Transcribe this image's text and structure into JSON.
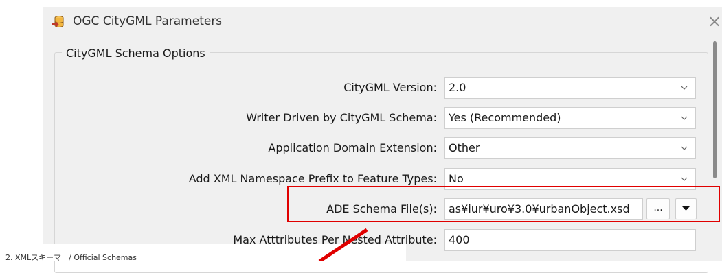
{
  "dialog": {
    "title": "OGC CityGML Parameters",
    "title_icon": "database-export-icon",
    "close_label": "×"
  },
  "group": {
    "title": "CityGML Schema Options"
  },
  "params": [
    {
      "label": "CityGML Version:",
      "value": "2.0"
    },
    {
      "label": "Writer Driven by CityGML Schema:",
      "value": "Yes (Recommended)"
    },
    {
      "label": "Application Domain Extension:",
      "value": "Other"
    },
    {
      "label": "Add XML Namespace Prefix to Feature Types:",
      "value": "No"
    },
    {
      "label": "ADE Schema File(s):",
      "value": "as¥iur¥uro¥3.0¥urbanObject.xsd"
    },
    {
      "label": "Max Atttributes Per Nested Attribute:",
      "value": "400"
    }
  ],
  "buttons": {
    "browse_label": "..."
  },
  "footer": {
    "caption": "2. XMLスキーマ　/ Official Schemas"
  },
  "colors": {
    "highlight": "#e00000",
    "arrow": "#e00000",
    "dialog_bg": "#f0f0f0"
  }
}
